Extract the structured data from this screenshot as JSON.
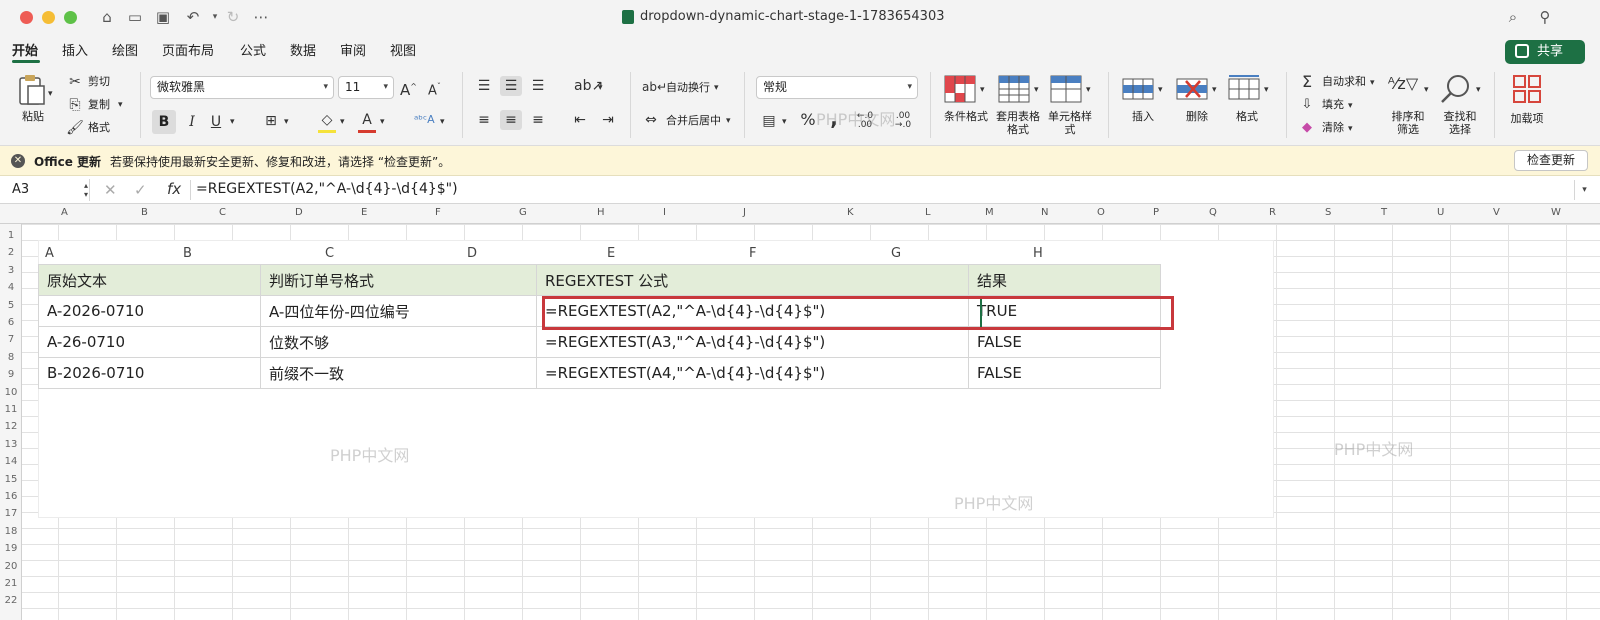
{
  "window": {
    "title": "dropdown-dynamic-chart-stage-1-1783654303"
  },
  "tabs": [
    "开始",
    "插入",
    "绘图",
    "页面布局",
    "公式",
    "数据",
    "审阅",
    "视图"
  ],
  "share_label": "共享",
  "ribbon": {
    "paste": "粘贴",
    "cut": "剪切",
    "copy": "复制",
    "format_painter": "格式",
    "font_name": "微软雅黑",
    "font_size": "11",
    "bold": "B",
    "italic": "I",
    "underline": "U",
    "wrap_text": "自动换行",
    "merge_center": "合并后居中",
    "number_format": "常规",
    "conditional_format": "条件格式",
    "table_format": "套用表格格式",
    "cell_style": "单元格样式",
    "insert": "插入",
    "delete": "删除",
    "format": "格式",
    "autosum": "自动求和",
    "fill": "填充",
    "clear": "清除",
    "sort_filter": "排序和筛选",
    "find_select": "查找和选择",
    "addins": "加载项"
  },
  "update_bar": {
    "title": "Office 更新",
    "message": "若要保持使用最新安全更新、修复和改进，请选择 “检查更新”。",
    "button": "检查更新"
  },
  "formula_bar": {
    "name_box": "A3",
    "fx": "fx",
    "formula": "=REGEXTEST(A2,\"^A-\\d{4}-\\d{4}$\")"
  },
  "sheet": {
    "column_headers": [
      "A",
      "B",
      "C",
      "D",
      "E",
      "F",
      "G",
      "H",
      "I",
      "J",
      "K",
      "L",
      "M",
      "N",
      "O",
      "P",
      "Q",
      "R",
      "S",
      "T",
      "U",
      "V",
      "W"
    ],
    "row_headers": [
      "1",
      "2",
      "3",
      "4",
      "5",
      "6",
      "7",
      "8",
      "9",
      "10",
      "11",
      "12",
      "13",
      "14",
      "15",
      "16",
      "17",
      "18",
      "19",
      "20",
      "21",
      "22"
    ]
  },
  "example": {
    "column_headers": [
      "A",
      "B",
      "C",
      "D",
      "E",
      "F",
      "G",
      "H"
    ],
    "table": {
      "headers": [
        "原始文本",
        "判断订单号格式",
        "REGEXTEST 公式",
        "结果"
      ],
      "rows": [
        [
          "A-2026-0710",
          "A-四位年份-四位编号",
          "=REGEXTEST(A2,\"^A-\\d{4}-\\d{4}$\")",
          "TRUE"
        ],
        [
          "A-26-0710",
          "位数不够",
          "=REGEXTEST(A3,\"^A-\\d{4}-\\d{4}$\")",
          "FALSE"
        ],
        [
          "B-2026-0710",
          "前缀不一致",
          "=REGEXTEST(A4,\"^A-\\d{4}-\\d{4}$\")",
          "FALSE"
        ]
      ]
    }
  },
  "watermark": "PHP中文网",
  "colors": {
    "accent": "#1d7044",
    "header_fill": "#e3edd9",
    "highlight_border": "#c8383c",
    "update_bar": "#fdf6d9"
  }
}
